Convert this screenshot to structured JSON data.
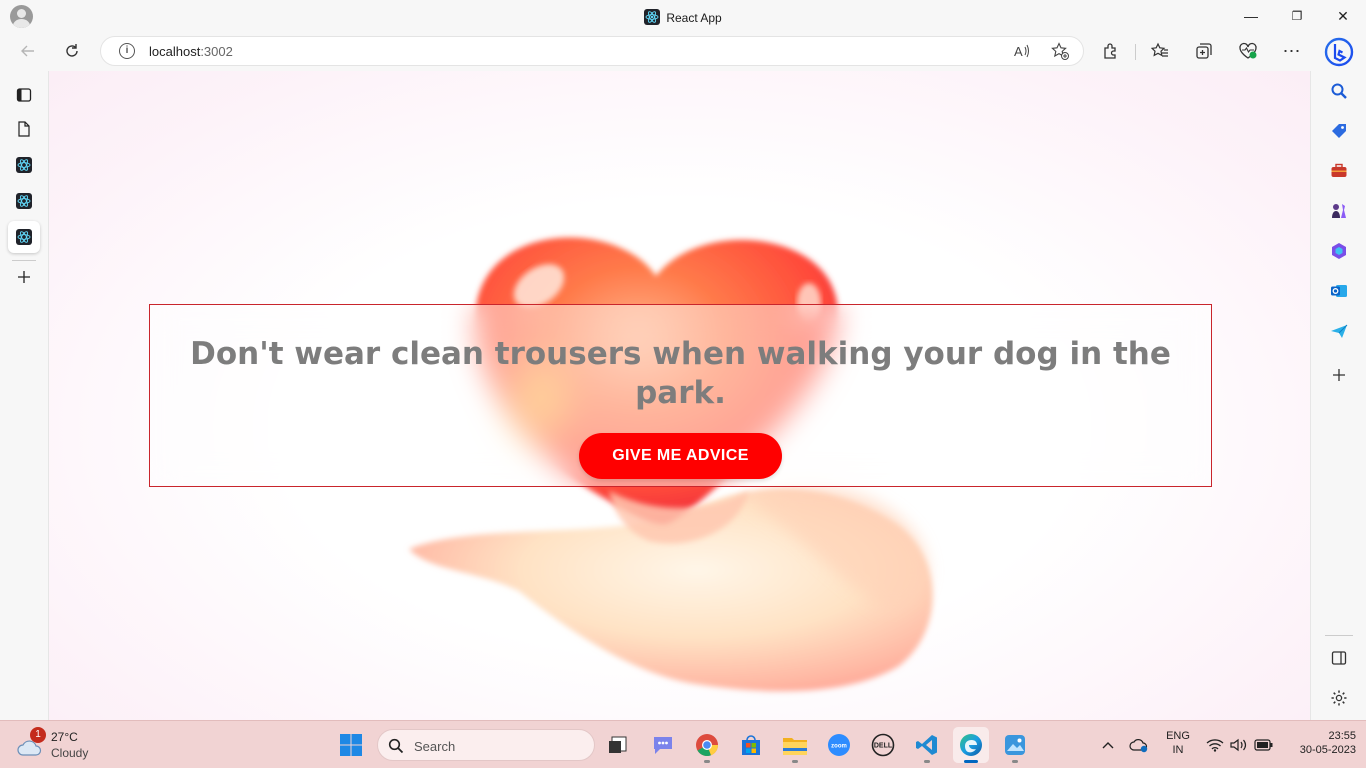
{
  "window": {
    "title": "React App",
    "controls": {
      "minimize": "—",
      "restore": "❐",
      "close": "✕"
    }
  },
  "addressbar": {
    "host": "localhost",
    "port": ":3002"
  },
  "page": {
    "advice": "Don't wear clean trousers when walking your dog in the park.",
    "button_label": "GIVE ME ADVICE"
  },
  "taskbar": {
    "weather": {
      "temp": "27°C",
      "condition": "Cloudy",
      "badge": "1"
    },
    "search_label": "Search",
    "language": {
      "line1": "ENG",
      "line2": "IN"
    },
    "clock": {
      "time": "23:55",
      "date": "30-05-2023"
    }
  },
  "colors": {
    "accent_button": "#ff0000",
    "card_border": "#c9252c",
    "advice_text": "#7d7d7d",
    "taskbar_bg": "#f1d3d3"
  }
}
